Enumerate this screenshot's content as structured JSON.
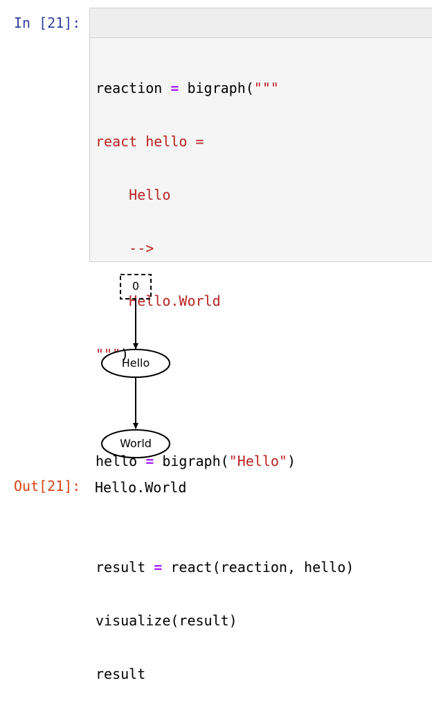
{
  "input_prompt": "In [21]:",
  "output_prompt": "Out[21]:",
  "code": {
    "line1": {
      "a": "reaction ",
      "op": "=",
      "b": " bigraph(",
      "s": "\"\"\""
    },
    "line2": {
      "s": "react hello ="
    },
    "line3": {
      "s": "    Hello"
    },
    "line4": {
      "s": "    -->"
    },
    "line5": {
      "s": "    Hello.World"
    },
    "line6": {
      "s": "\"\"\"",
      "b": ")"
    },
    "line8": {
      "a": "hello ",
      "op": "=",
      "b": " bigraph(",
      "s": "\"Hello\"",
      "c": ")"
    },
    "line10": {
      "a": "result ",
      "op": "=",
      "b": " react(reaction, hello)"
    },
    "line11": {
      "a": "visualize(result)"
    },
    "line12": {
      "a": "result"
    }
  },
  "graph": {
    "root_label": "0",
    "node1_label": "Hello",
    "node2_label": "World"
  },
  "output_value": "Hello.World",
  "colors": {
    "input_prompt": "#303f9f",
    "output_prompt": "#d84315",
    "operator": "#aa22ff",
    "string": "#ba2121",
    "cell_bg": "#f5f5f5"
  }
}
